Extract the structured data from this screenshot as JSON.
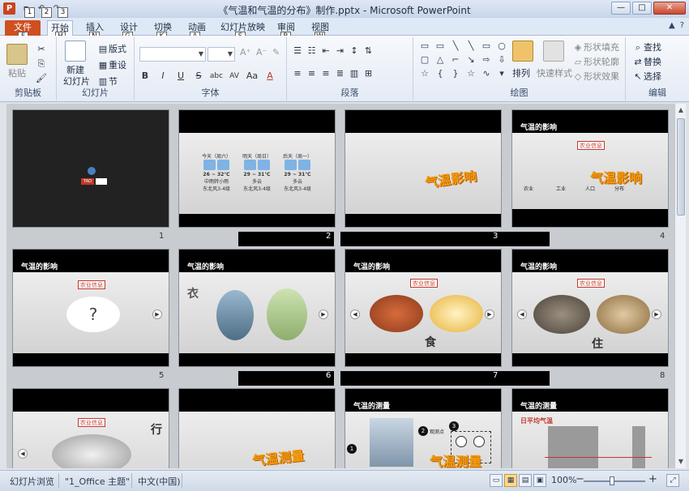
{
  "window": {
    "title": "《气温和气温的分布》制作.pptx  -  Microsoft PowerPoint",
    "app_icon_letter": "P",
    "qat_keytips": [
      "1",
      "2",
      "3"
    ],
    "controls": {
      "minimize": "—",
      "maximize": "□",
      "close": "✕"
    }
  },
  "tabs": [
    {
      "label": "文件",
      "keytip": "F"
    },
    {
      "label": "开始",
      "keytip": "H"
    },
    {
      "label": "插入",
      "keytip": "N"
    },
    {
      "label": "设计",
      "keytip": "G"
    },
    {
      "label": "切换",
      "keytip": "K"
    },
    {
      "label": "动画",
      "keytip": "A"
    },
    {
      "label": "幻灯片放映",
      "keytip": "S"
    },
    {
      "label": "审阅",
      "keytip": "R"
    },
    {
      "label": "视图",
      "keytip": "W"
    }
  ],
  "ribbon": {
    "clipboard": {
      "label": "剪贴板",
      "paste": "粘贴"
    },
    "slides": {
      "label": "幻灯片",
      "new_slide_1": "新建",
      "new_slide_2": "幻灯片",
      "layout": "版式",
      "reset": "重设",
      "section": "节"
    },
    "font": {
      "label": "字体",
      "bold": "B",
      "italic": "I",
      "underline": "U",
      "strike": "S",
      "shadow": "abc",
      "spacing": "AV",
      "case": "Aa",
      "color": "A"
    },
    "paragraph": {
      "label": "段落"
    },
    "drawing": {
      "label": "绘图",
      "arrange": "排列",
      "quick_styles": "快速样式",
      "shape_fill": "形状填充",
      "shape_outline": "形状轮廓",
      "shape_effects": "形状效果"
    },
    "editing": {
      "label": "编辑",
      "find": "查找",
      "replace": "替换",
      "select": "选择"
    }
  },
  "slides": [
    {
      "number": "1",
      "label_text": "TAD"
    },
    {
      "number": "2"
    },
    {
      "number": "3",
      "wordart": "气温影响"
    },
    {
      "number": "4",
      "tag": "农业信息",
      "wordart": "气温影响",
      "header": "气温的影响",
      "captions": [
        "农业",
        "工业",
        "人口",
        "分布"
      ]
    },
    {
      "number": "5",
      "tag": "农业信息",
      "header": "气温的影响",
      "question": "?"
    },
    {
      "number": "6",
      "header": "气温的影响",
      "side": "衣"
    },
    {
      "number": "7",
      "tag": "农业信息",
      "header": "气温的影响",
      "side": "食"
    },
    {
      "number": "8",
      "tag": "农业信息",
      "header": "气温的影响",
      "side": "住"
    },
    {
      "number": "9",
      "tag": "农业信息",
      "side": "行"
    },
    {
      "number": "10",
      "wordart": "气温测量"
    },
    {
      "number": "11",
      "header": "气温的测量",
      "wordart": "气温测量",
      "badges": [
        "1",
        "2",
        "3"
      ],
      "label": "观测点"
    },
    {
      "number": "12",
      "header": "气温的测量",
      "chart_label": "日平均气温"
    }
  ],
  "weather": {
    "cities": [
      {
        "name": "今天（周六）",
        "temp": "26 ~ 32℃",
        "desc": "中雨转小雨",
        "wind": "东北风3-4级"
      },
      {
        "name": "明天（周日）",
        "temp": "29 ~ 31℃",
        "desc": "多云",
        "wind": "东北风3-4级"
      },
      {
        "name": "后天（周一）",
        "temp": "29 ~ 31℃",
        "desc": "多云",
        "wind": "东北风3-4级"
      }
    ]
  },
  "status": {
    "view_name": "幻灯片浏览",
    "theme": "\"1_Office 主题\"",
    "language": "中文(中国)",
    "zoom": "100%",
    "zoom_minus": "−",
    "zoom_plus": "+"
  },
  "colors": {
    "file_tab": "#cf4f21",
    "accent_orange": "#f39c12",
    "tag_red": "#c0392b"
  }
}
